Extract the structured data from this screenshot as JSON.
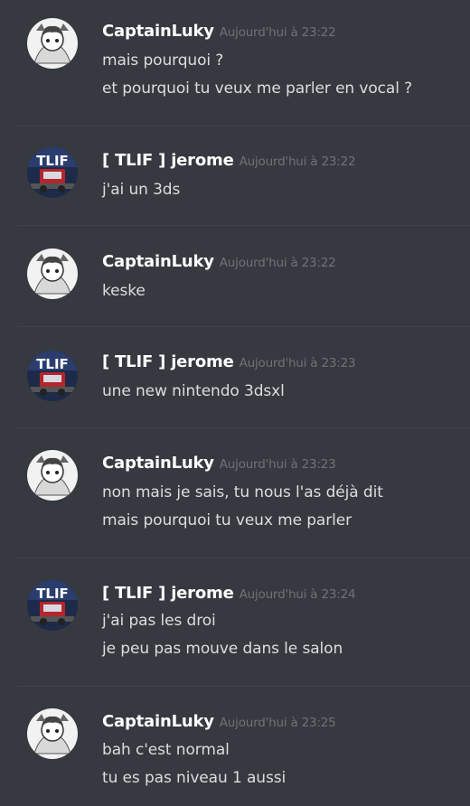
{
  "colors": {
    "background": "#36393f",
    "author": "#ffffff",
    "timestamp": "#6f7277",
    "text": "#dcddde"
  },
  "messages": [
    {
      "author": "CaptainLuky",
      "timestamp": "Aujourd'hui à 23:22",
      "avatar": "captainluky-avatar",
      "lines": [
        "mais pourquoi ?",
        "et pourquoi tu veux me parler en vocal ?"
      ]
    },
    {
      "author": "[ TLIF ] jerome",
      "timestamp": "Aujourd'hui à 23:22",
      "avatar": "tlif-avatar",
      "lines": [
        "j'ai un 3ds"
      ]
    },
    {
      "author": "CaptainLuky",
      "timestamp": "Aujourd'hui à 23:22",
      "avatar": "captainluky-avatar",
      "lines": [
        "keske"
      ]
    },
    {
      "author": "[ TLIF ] jerome",
      "timestamp": "Aujourd'hui à 23:23",
      "avatar": "tlif-avatar",
      "lines": [
        "une new nintendo 3dsxl"
      ]
    },
    {
      "author": "CaptainLuky",
      "timestamp": "Aujourd'hui à 23:23",
      "avatar": "captainluky-avatar",
      "lines": [
        "non mais je sais, tu nous l'as déjà dit",
        "mais pourquoi tu veux me parler"
      ]
    },
    {
      "author": "[ TLIF ] jerome",
      "timestamp": "Aujourd'hui à 23:24",
      "avatar": "tlif-avatar",
      "lines": [
        "j'ai pas les droi",
        "je peu pas mouve dans le salon"
      ]
    },
    {
      "author": "CaptainLuky",
      "timestamp": "Aujourd'hui à 23:25",
      "avatar": "captainluky-avatar",
      "lines": [
        "bah c'est normal",
        "tu es pas niveau 1 aussi"
      ]
    }
  ]
}
